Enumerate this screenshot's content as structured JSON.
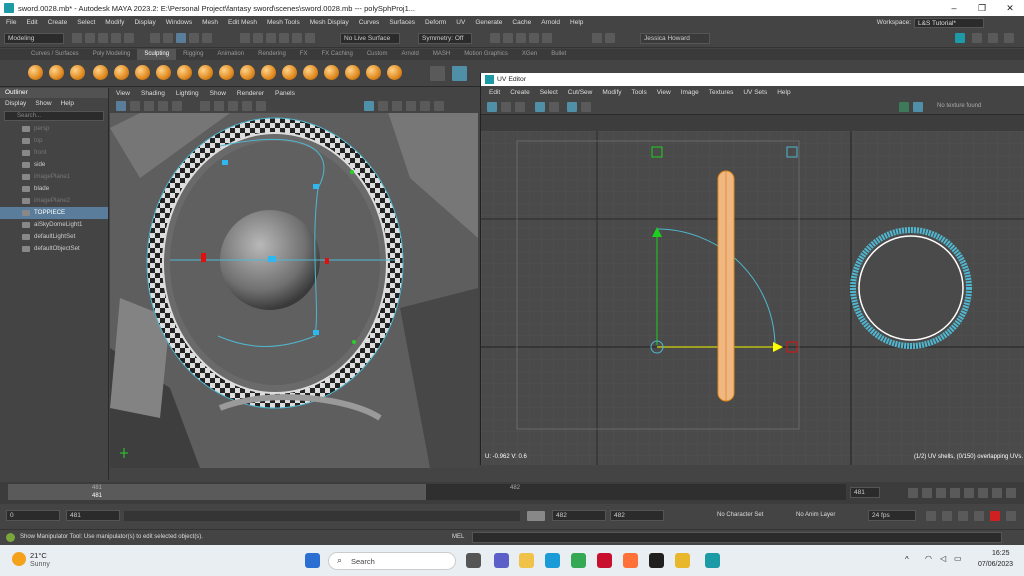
{
  "window": {
    "title": "sword.0028.mb* - Autodesk MAYA 2023.2: E:\\Personal Project\\fantasy sword\\scenes\\sword.0028.mb  ---  polySphProj1..."
  },
  "menubar": [
    "File",
    "Edit",
    "Create",
    "Select",
    "Modify",
    "Display",
    "Windows",
    "Mesh",
    "Edit Mesh",
    "Mesh Tools",
    "Mesh Display",
    "Curves",
    "Surfaces",
    "Deform",
    "UV",
    "Generate",
    "Cache",
    "Arnold",
    "Help"
  ],
  "workspace": {
    "label": "Workspace:",
    "value": "L&S Tutorial*"
  },
  "statusline": {
    "mode": "Modeling",
    "live": "No Live Surface",
    "symmetry": "Symmetry: Off",
    "user": "Jessica Howard"
  },
  "shelf_tabs": [
    "Curves / Surfaces",
    "Poly Modeling",
    "Sculpting",
    "Rigging",
    "Animation",
    "Rendering",
    "FX",
    "FX Caching",
    "Custom",
    "Arnold",
    "MASH",
    "Motion Graphics",
    "XGen",
    "Bullet"
  ],
  "shelf_active": "Sculpting",
  "outliner": {
    "title": "Outliner",
    "menu": [
      "Display",
      "Show",
      "Help"
    ],
    "search_placeholder": "Search...",
    "items": [
      {
        "label": "persp",
        "state": "dim"
      },
      {
        "label": "top",
        "state": "dim"
      },
      {
        "label": "front",
        "state": "dim"
      },
      {
        "label": "side",
        "state": "normal"
      },
      {
        "label": "imagePlane1",
        "state": "dim"
      },
      {
        "label": "blade",
        "state": "normal"
      },
      {
        "label": "imagePlane2",
        "state": "dim"
      },
      {
        "label": "TOPPIECE",
        "state": "sel"
      },
      {
        "label": "aiSkyDomeLight1",
        "state": "normal"
      },
      {
        "label": "defaultLightSet",
        "state": "normal"
      },
      {
        "label": "defaultObjectSet",
        "state": "normal"
      }
    ]
  },
  "viewport": {
    "menu": [
      "View",
      "Shading",
      "Lighting",
      "Show",
      "Renderer",
      "Panels"
    ]
  },
  "uv_editor": {
    "title": "UV Editor",
    "menu": [
      "Edit",
      "Create",
      "Select",
      "Cut/Sew",
      "Modify",
      "Tools",
      "View",
      "Image",
      "Textures",
      "UV Sets",
      "Help"
    ],
    "texture": "No texture found",
    "coords": "U: -0.962  V:  0.6",
    "shells_info": "(1/2) UV shells, (0/150) overlapping UVs."
  },
  "timeline": {
    "start": "481",
    "current": "482",
    "end_field": "481"
  },
  "range": {
    "start": "0",
    "range_start": "481",
    "range_end": "482",
    "end": "482",
    "character_set": "No Character Set",
    "anim_layer": "No Anim Layer",
    "fps": "24 fps"
  },
  "help_line": "Show Manipulator Tool: Use manipulator(s) to edit selected object(s).",
  "cmd_label": "MEL",
  "taskbar": {
    "temp": "21°C",
    "weather": "Sunny",
    "search": "Search",
    "time": "16:25",
    "date": "07/06/2023"
  },
  "colors": {
    "accent": "#1c9aa6",
    "selection": "#5a7d9b",
    "sphere_icon": "#e08a1e"
  }
}
